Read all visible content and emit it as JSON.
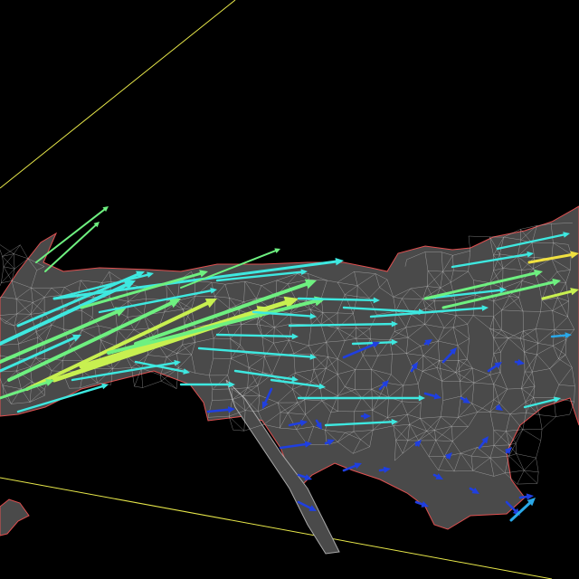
{
  "view": {
    "background": "#000000",
    "bounding_box_color": "#e8e84a",
    "surface_fill": "#4a4a4a",
    "mesh_color": "#d8d8d8",
    "surface_edge_color": "#e05050"
  },
  "legend": {
    "vector_color_scale": [
      "#1f3fe0",
      "#2aa8e8",
      "#3ee8e0",
      "#6ef080",
      "#c8f050",
      "#f0e040"
    ],
    "description_visible": false
  }
}
